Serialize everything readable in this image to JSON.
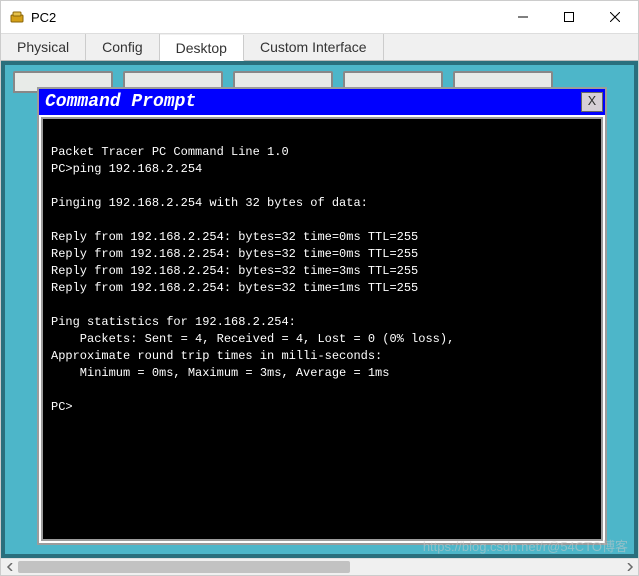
{
  "window": {
    "title": "PC2"
  },
  "tabs": {
    "items": [
      {
        "label": "Physical"
      },
      {
        "label": "Config"
      },
      {
        "label": "Desktop"
      },
      {
        "label": "Custom Interface"
      }
    ],
    "active_index": 2
  },
  "cmd": {
    "title": "Command Prompt",
    "close_label": "X",
    "lines": [
      "",
      "Packet Tracer PC Command Line 1.0",
      "PC>ping 192.168.2.254",
      "",
      "Pinging 192.168.2.254 with 32 bytes of data:",
      "",
      "Reply from 192.168.2.254: bytes=32 time=0ms TTL=255",
      "Reply from 192.168.2.254: bytes=32 time=0ms TTL=255",
      "Reply from 192.168.2.254: bytes=32 time=3ms TTL=255",
      "Reply from 192.168.2.254: bytes=32 time=1ms TTL=255",
      "",
      "Ping statistics for 192.168.2.254:",
      "    Packets: Sent = 4, Received = 4, Lost = 0 (0% loss),",
      "Approximate round trip times in milli-seconds:",
      "    Minimum = 0ms, Maximum = 3ms, Average = 1ms",
      "",
      "PC>"
    ]
  },
  "watermark": "https://blog.csdn.net/r@54CTO博客"
}
